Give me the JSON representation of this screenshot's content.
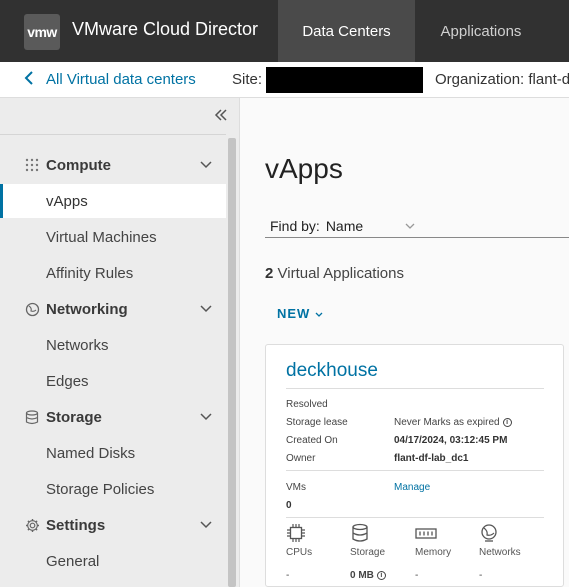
{
  "header": {
    "logo_text": "vmw",
    "app_title": "VMware Cloud Director",
    "tabs": [
      {
        "label": "Data Centers",
        "active": true
      },
      {
        "label": "Applications",
        "active": false
      }
    ]
  },
  "subheader": {
    "back_label": "All Virtual data centers",
    "site_label": "Site:",
    "org_label": "Organization: flant-d"
  },
  "sidebar": {
    "groups": [
      {
        "label": "Compute",
        "icon": "grid-icon",
        "items": [
          {
            "label": "vApps",
            "active": true
          },
          {
            "label": "Virtual Machines",
            "active": false
          },
          {
            "label": "Affinity Rules",
            "active": false
          }
        ]
      },
      {
        "label": "Networking",
        "icon": "globe-icon",
        "items": [
          {
            "label": "Networks",
            "active": false
          },
          {
            "label": "Edges",
            "active": false
          }
        ]
      },
      {
        "label": "Storage",
        "icon": "database-icon",
        "items": [
          {
            "label": "Named Disks",
            "active": false
          },
          {
            "label": "Storage Policies",
            "active": false
          }
        ]
      },
      {
        "label": "Settings",
        "icon": "gear-icon",
        "items": [
          {
            "label": "General",
            "active": false
          }
        ]
      }
    ]
  },
  "main": {
    "title": "vApps",
    "find_by_label": "Find by:",
    "find_by_value": "Name",
    "count_number": "2",
    "count_label": "Virtual Applications",
    "new_button": "NEW"
  },
  "card": {
    "title": "deckhouse",
    "status": "Resolved",
    "storage_lease_label": "Storage lease",
    "storage_lease_value": "Never Marks as expired",
    "created_on_label": "Created On",
    "created_on_value": "04/17/2024, 03:12:45 PM",
    "owner_label": "Owner",
    "owner_value": "flant-df-lab_dc1",
    "vms_label": "VMs",
    "vms_value": "0",
    "manage_link": "Manage",
    "resources": [
      {
        "label": "CPUs",
        "value": "-",
        "icon": "cpu-icon"
      },
      {
        "label": "Storage",
        "value": "0 MB",
        "icon": "storage-icon"
      },
      {
        "label": "Memory",
        "value": "-",
        "icon": "memory-icon"
      },
      {
        "label": "Networks",
        "value": "-",
        "icon": "network-icon"
      }
    ]
  },
  "colors": {
    "header_bg": "#313131",
    "accent": "#0072a3",
    "sidebar_bg": "#ececec"
  }
}
